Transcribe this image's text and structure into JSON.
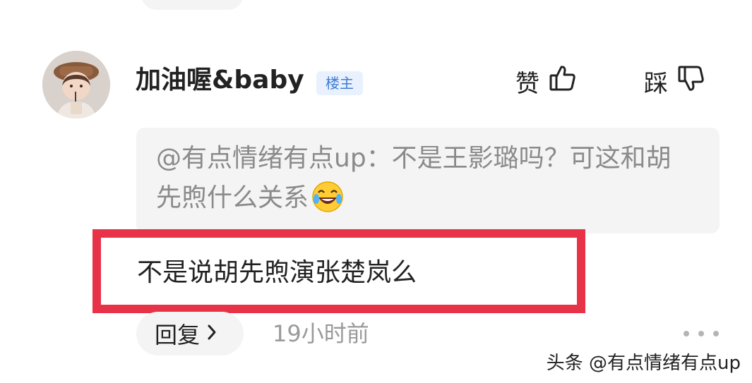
{
  "comment": {
    "username": "加油喔&baby",
    "badge": "楼主",
    "like_label": "赞",
    "dislike_label": "踩",
    "quote_text": "@有点情绪有点up：不是王影璐吗？可这和胡先煦什么关系",
    "quote_emoji": "laughing-crying-emoji",
    "reply_text": "不是说胡先煦演张楚岚么",
    "reply_button_label": "回复",
    "timestamp": "19小时前"
  },
  "watermark": "头条 @有点情绪有点up",
  "colors": {
    "highlight_border": "#e83248",
    "badge_text": "#3f7dd1",
    "badge_bg": "#e8f1fd",
    "quote_bg": "#f4f4f5",
    "muted_text": "#9a9a9a"
  },
  "icons": {
    "like": "thumbs-up-icon",
    "dislike": "thumbs-down-icon",
    "reply_arrow": "chevron-right-icon",
    "more": "more-dots-icon"
  }
}
